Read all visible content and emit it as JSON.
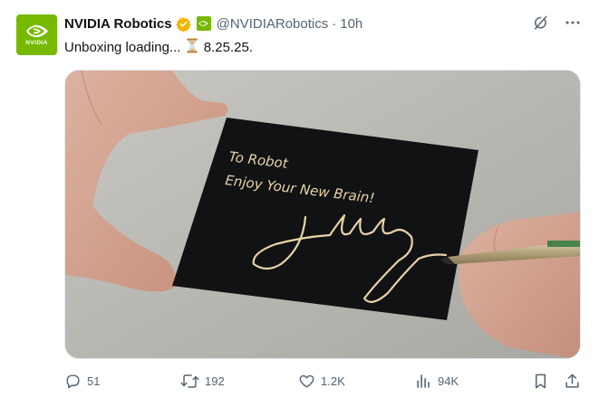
{
  "author": {
    "display_name": "NVIDIA Robotics",
    "handle": "@NVIDIARobotics",
    "separator": "·",
    "time": "10h",
    "avatar_text": "NVIDIA"
  },
  "tweet": {
    "text_before": "Unboxing loading...",
    "text_after": "8.25.25."
  },
  "media": {
    "card_lines": [
      "To Robot",
      "Enjoy Your New Brain!"
    ]
  },
  "actions": {
    "replies": "51",
    "reposts": "192",
    "likes": "1.2K",
    "views": "94K"
  },
  "colors": {
    "brand": "#76b900",
    "verified": "#f4b400",
    "muted": "#536471"
  },
  "icons": {
    "reply": "speech-bubble-icon",
    "repost": "repost-arrows-icon",
    "like": "heart-icon",
    "views": "bar-chart-icon",
    "bookmark": "bookmark-icon",
    "share": "share-upload-icon",
    "grok": "grok-slash-icon",
    "more": "more-dots-icon"
  }
}
